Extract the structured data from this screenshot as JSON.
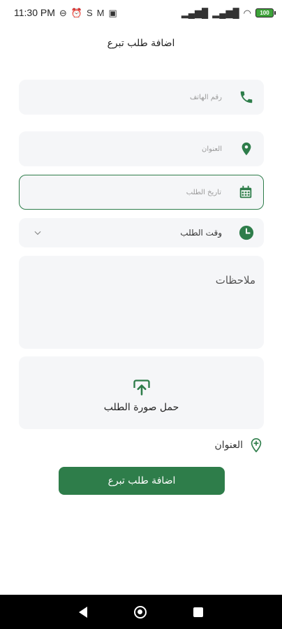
{
  "status_bar": {
    "time": "11:30 PM",
    "icons_left": [
      "dnd-icon",
      "alarm-icon",
      "sync-icon",
      "gmail-icon",
      "screen-icon"
    ],
    "battery": "100"
  },
  "page": {
    "title": "اضافة طلب تبرع"
  },
  "form": {
    "phone_placeholder": "رقم الهاتف",
    "address_placeholder": "العنوان",
    "date_placeholder": "تاريخ الطلب",
    "time_label": "وقت الطلب",
    "notes_label": "ملاحظات",
    "upload_label": "حمل صورة الطلب",
    "add_address_label": "العنوان",
    "submit_label": "اضافة طلب تبرع"
  },
  "colors": {
    "accent": "#2e7d4a",
    "field_bg": "#f5f6f8"
  }
}
